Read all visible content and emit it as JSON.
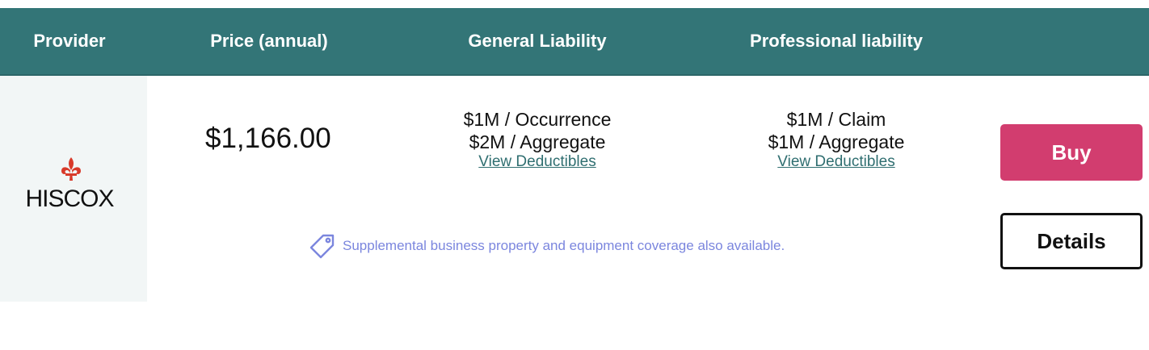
{
  "table": {
    "headers": {
      "provider": "Provider",
      "price": "Price (annual)",
      "general_liability": "General Liability",
      "professional_liability": "Professional liability"
    },
    "row": {
      "provider_name": "HISCOX",
      "price": "$1,166.00",
      "general_liability": {
        "line1": "$1M / Occurrence",
        "line2": "$2M / Aggregate",
        "link": "View Deductibles"
      },
      "professional_liability": {
        "line1": "$1M / Claim",
        "line2": "$1M / Aggregate",
        "link": "View Deductibles"
      },
      "note": "Supplemental business property and equipment coverage also available.",
      "buy_label": "Buy",
      "details_label": "Details"
    }
  },
  "colors": {
    "header_bg": "#337577",
    "buy_bg": "#d23d6f",
    "link": "#2f6e70",
    "note": "#7b86de",
    "logo_mark": "#d83a2a"
  },
  "icons": {
    "logo_mark": "fleur-de-lis-icon",
    "note_icon": "tag-icon"
  }
}
